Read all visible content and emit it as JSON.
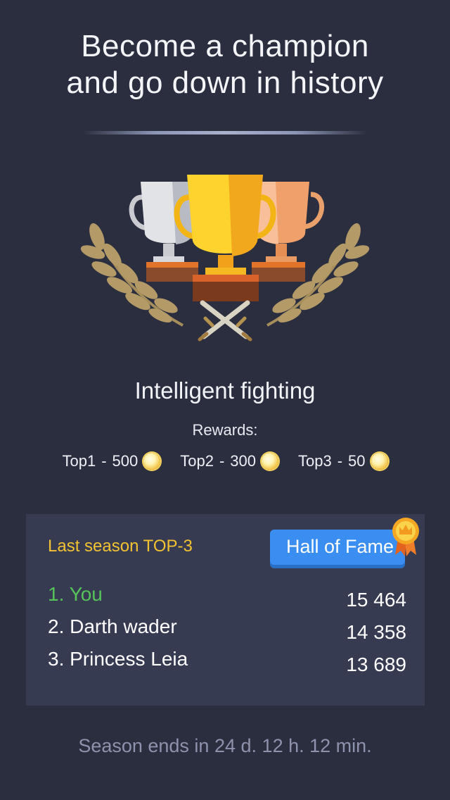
{
  "headline": {
    "line1": "Become a champion",
    "line2": "and go down in history"
  },
  "game_title": "Intelligent fighting",
  "rewards": {
    "label": "Rewards:",
    "items": [
      {
        "label": "Top1",
        "separator": "-",
        "amount": "500",
        "icon": "coin-icon"
      },
      {
        "label": "Top2",
        "separator": "-",
        "amount": "300",
        "icon": "coin-icon"
      },
      {
        "label": "Top3",
        "separator": "-",
        "amount": "50",
        "icon": "coin-icon"
      }
    ]
  },
  "leaderboard": {
    "title": "Last season TOP-3",
    "hall_of_fame_label": "Hall of Fame",
    "entries": [
      {
        "name": "1. You",
        "score": "15 464"
      },
      {
        "name": "2. Darth wader",
        "score": "14 358"
      },
      {
        "name": "3. Princess Leia",
        "score": "13 689"
      }
    ]
  },
  "season": {
    "prefix": "Season ends in",
    "days": "24 d.",
    "hours": "12 h.",
    "minutes": "12 min."
  },
  "colors": {
    "background": "#2a2e3f",
    "panel": "#373b52",
    "accent_yellow": "#f2c230",
    "accent_green": "#56c25a",
    "button_blue": "#3b8ef1",
    "muted_text": "#8e93ad"
  }
}
